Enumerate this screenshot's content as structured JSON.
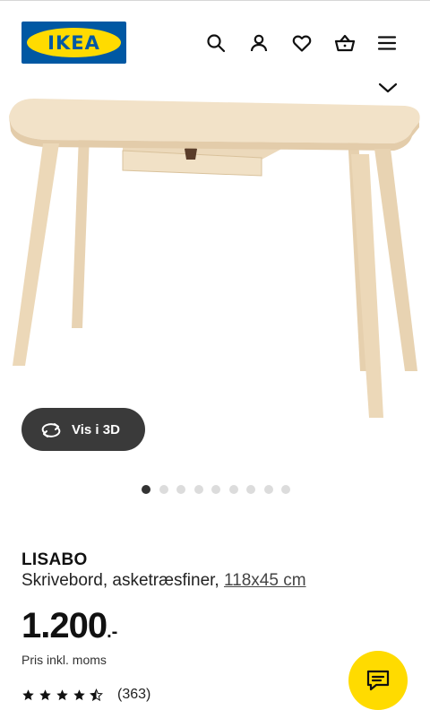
{
  "brand": {
    "logo_text": "IKEA",
    "blue": "#0058a3",
    "yellow": "#ffdb00"
  },
  "header": {
    "icons": [
      "search-icon",
      "user-icon",
      "heart-icon",
      "basket-icon",
      "menu-icon"
    ]
  },
  "gallery": {
    "view3d_label": "Vis i 3D",
    "dot_count": 9,
    "active_dot": 1
  },
  "product": {
    "name": "LISABO",
    "description": "Skrivebord, asketræsfiner,",
    "dimensions": "118x45 cm",
    "price_main": "1.200",
    "price_suffix": ".-",
    "vat_note": "Pris inkl. moms",
    "rating_value": 4.5,
    "rating_max": 5,
    "review_count": "(363)"
  },
  "colors": {
    "chat_button": "#ffdb00",
    "dark_button": "#3a3a3a"
  }
}
